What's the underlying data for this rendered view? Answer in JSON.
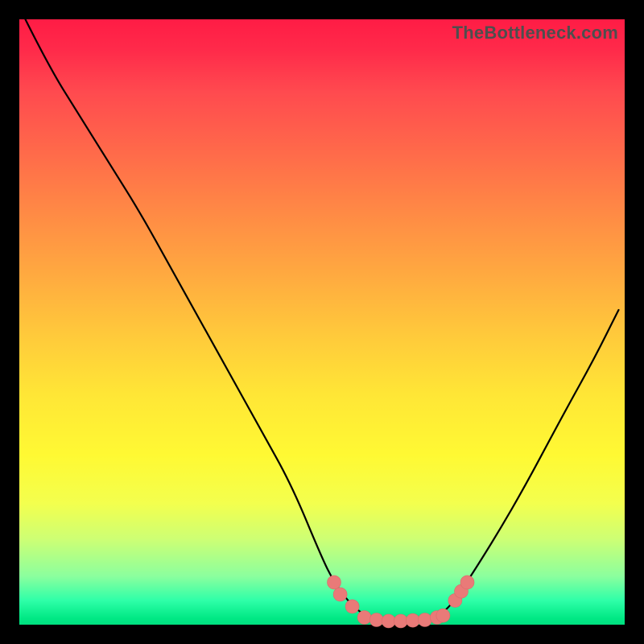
{
  "watermark": "TheBottleneck.com",
  "colors": {
    "page_bg": "#000000",
    "curve_stroke": "#000000",
    "dot_fill": "#e97a78",
    "gradient_top": "#ff1c45",
    "gradient_bottom": "#00e080"
  },
  "chart_data": {
    "type": "line",
    "title": "",
    "xlabel": "",
    "ylabel": "",
    "xlim": [
      0,
      100
    ],
    "ylim": [
      0,
      100
    ],
    "grid": false,
    "legend": false,
    "note": "Values reverse-engineered from pixel positions; y is percent height from bottom (0 = bottom / green, 100 = top / red).",
    "series": [
      {
        "name": "bottleneck-curve",
        "x": [
          1,
          5,
          10,
          15,
          20,
          25,
          30,
          35,
          40,
          45,
          50,
          52,
          55,
          58,
          62,
          66,
          70,
          74,
          82,
          90,
          95,
          99
        ],
        "y": [
          100,
          92,
          84,
          76,
          68,
          59,
          50,
          41,
          32,
          23,
          11,
          7,
          3,
          1,
          0.5,
          0.7,
          1.5,
          7,
          20,
          35,
          44,
          52
        ]
      }
    ],
    "markers": {
      "name": "highlighted-dots",
      "comment": "Pink dots clustered around the curve minimum near the bottom.",
      "points": [
        {
          "x": 52,
          "y": 7
        },
        {
          "x": 53,
          "y": 5
        },
        {
          "x": 55,
          "y": 3
        },
        {
          "x": 57,
          "y": 1.2
        },
        {
          "x": 59,
          "y": 0.8
        },
        {
          "x": 61,
          "y": 0.6
        },
        {
          "x": 63,
          "y": 0.6
        },
        {
          "x": 65,
          "y": 0.7
        },
        {
          "x": 67,
          "y": 0.8
        },
        {
          "x": 69,
          "y": 1.2
        },
        {
          "x": 70,
          "y": 1.5
        },
        {
          "x": 72,
          "y": 4
        },
        {
          "x": 73,
          "y": 5.5
        },
        {
          "x": 74,
          "y": 7
        }
      ]
    }
  }
}
